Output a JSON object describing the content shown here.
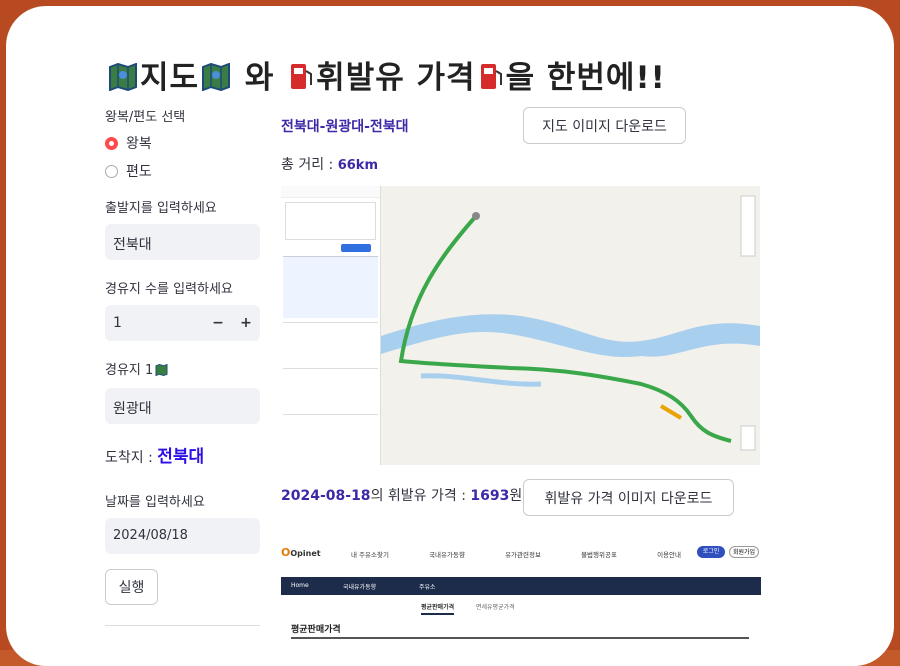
{
  "title": {
    "p1": "지도",
    "p2": "와",
    "p3": "휘발유 가격",
    "p4": "을 한번에!!"
  },
  "sidebar": {
    "trip_label": "왕복/편도 선택",
    "options": [
      "왕복",
      "편도"
    ],
    "selected": "왕복",
    "origin_label": "출발지를 입력하세요",
    "origin_value": "전북대",
    "waypoint_count_label": "경유지 수를 입력하세요",
    "waypoint_count": "1",
    "minus": "−",
    "plus": "+",
    "waypoint1_label": "경유지 1",
    "waypoint1_value": "원광대",
    "dest_label": "도착지 : ",
    "dest_value": "전북대",
    "date_label": "날짜를 입력하세요",
    "date_value": "2024/08/18",
    "run_button": "실행"
  },
  "main": {
    "route": "전북대-원광대-전북대",
    "map_download": "지도 이미지 다운로드",
    "distance_label": "총 거리 : ",
    "distance_value": "66km",
    "fuel_date": "2024-08-18",
    "fuel_mid": "의 휘발유 가격 : ",
    "fuel_price": "1693",
    "fuel_unit": "원",
    "fuel_download": "휘발유 가격 이미지 다운로드"
  },
  "opinet": {
    "logo": "Opinet",
    "menu": [
      "내 주유소찾기",
      "국내유가동향",
      "유가관련정보",
      "불법행위공표",
      "이용안내"
    ],
    "login": "로그인",
    "join": "회원가입",
    "nav": [
      "Home",
      "국내유가동향",
      "주유소"
    ],
    "subtabs": [
      "평균판매가격",
      "면세유평균가격"
    ],
    "section": "평균판매가격"
  },
  "colors": {
    "accent": "#3d29a6",
    "radio": "#ff4b4b",
    "border": "#b84a22"
  }
}
